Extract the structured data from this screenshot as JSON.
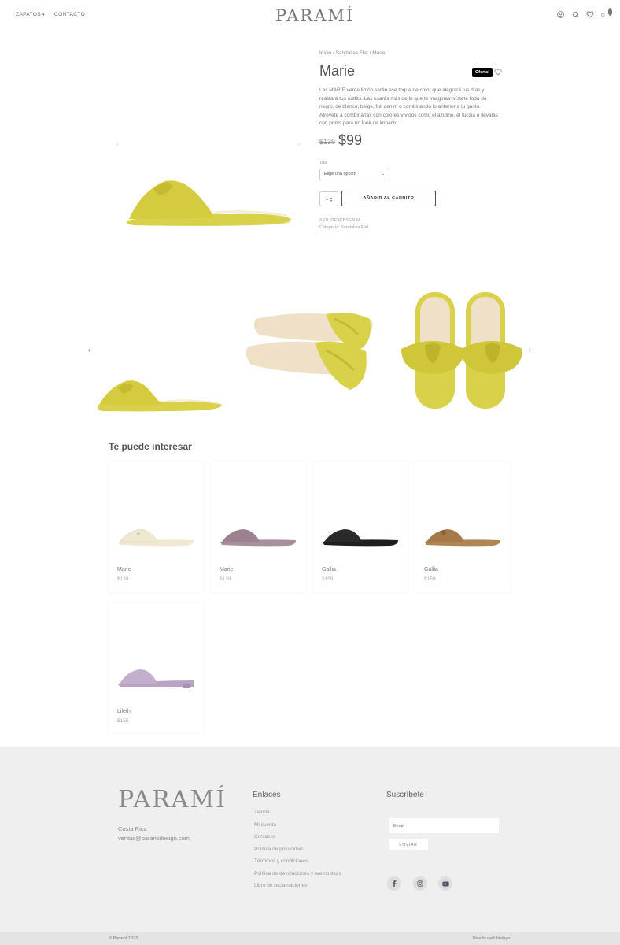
{
  "header": {
    "nav": [
      {
        "label": "ZAPATOS",
        "has_dropdown": true
      },
      {
        "label": "CONTACTO",
        "has_dropdown": false
      }
    ],
    "logo": "PARAMÍ",
    "icons": [
      "user-icon",
      "search-icon",
      "heart-icon",
      "cart-icon"
    ],
    "cart_count": "0"
  },
  "product": {
    "breadcrumb": "Inicio / Sandalias Flat / Marie",
    "title": "Marie",
    "badge": "Oferta!",
    "description": "Las MARIE verde limón serán ese toque de color que alegrará tus días y realzará tus outfits. Las usarás más de lo que te imaginas: vístete toda de negro, de blanco, beige, full denim o combinando lo anterior a tu gusto. Atrévete a combinarlas con colores vívidos como el azulino, el fucsia o llévalas con prints para un look de impacto.",
    "old_price": "$139",
    "price": "$99",
    "size_label": "Talla",
    "size_select": "Elige una opción",
    "quantity": "1",
    "add_to_cart": "AÑADIR AL CARRITO",
    "sku": "SKU: DESCBSFBLM",
    "category": "Categoría: Sandalias Flat",
    "color": "#d9d14a"
  },
  "related": {
    "title": "Te puede interesar",
    "items": [
      {
        "name": "Marie",
        "price": "$139",
        "color": "#efe9d2"
      },
      {
        "name": "Marie",
        "price": "$139",
        "color": "#a98f9c"
      },
      {
        "name": "Gallia",
        "price": "$159",
        "color": "#1e1e1e"
      },
      {
        "name": "Gallia",
        "price": "$159",
        "color": "#b08554"
      },
      {
        "name": "Lileth",
        "price": "$155",
        "color": "#b9a3c5"
      }
    ]
  },
  "footer": {
    "logo": "PARAMÍ",
    "location": "Costa Rica",
    "email": "ventas@paramidesign.com",
    "links_title": "Enlaces",
    "links": [
      "Tienda",
      "Mi cuenta",
      "Contacto",
      "Política de privacidad",
      "Términos y condiciones",
      "Política de devoluciones y reembolsos",
      "Libro de reclamaciones"
    ],
    "subscribe_title": "Suscríbete",
    "email_placeholder": "Email",
    "send_label": "ENVIAR",
    "social": [
      "facebook-icon",
      "instagram-icon",
      "youtube-icon"
    ],
    "copyright": "© Paramí 2023",
    "credit": "Diseño web bielbyro"
  }
}
